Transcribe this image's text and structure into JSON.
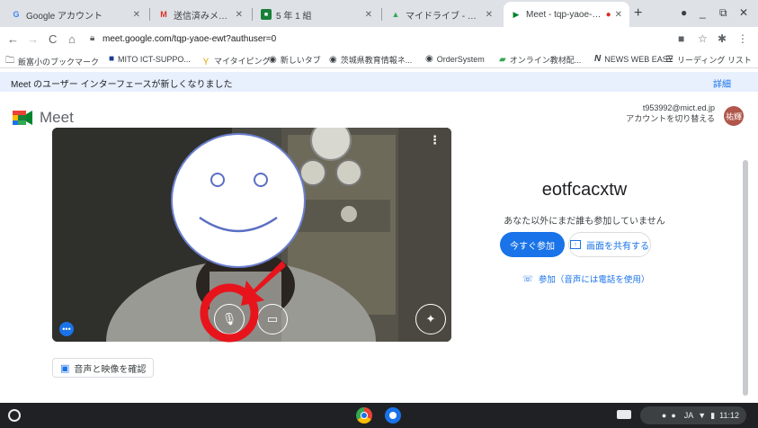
{
  "browser": {
    "tabs": [
      {
        "label": "Google アカウント",
        "icon": "google-g-icon",
        "icon_color": "#4285f4",
        "glyph": "G"
      },
      {
        "label": "送信済みメール - t953992@",
        "icon": "gmail-icon",
        "icon_color": "#d93025",
        "glyph": "M"
      },
      {
        "label": "5 年 1 組",
        "icon": "classroom-icon",
        "icon_color": "#188038",
        "glyph": "■"
      },
      {
        "label": "マイドライブ - Google ドラ",
        "icon": "drive-icon",
        "icon_color": "#fbbc04",
        "glyph": "▲"
      },
      {
        "label": "Meet - tqp-yaoe-ewt",
        "icon": "meet-icon",
        "icon_color": "#00832d",
        "glyph": "▶"
      }
    ],
    "url": "meet.google.com/tqp-yaoe-ewt?authuser=0",
    "bookmarks": [
      {
        "label": "飯富小のブックマーク",
        "icon": "folder-icon"
      },
      {
        "label": "MITO ICT-SUPPO...",
        "icon": "site-icon"
      },
      {
        "label": "マイタイピング",
        "icon": "typing-icon"
      },
      {
        "label": "新しいタブ",
        "icon": "globe-icon"
      },
      {
        "label": "茨城県教育情報ネ...",
        "icon": "globe-icon"
      },
      {
        "label": "OrderSystem",
        "icon": "globe-icon"
      },
      {
        "label": "オンライン教材配...",
        "icon": "site-icon"
      },
      {
        "label": "NEWS WEB EASY",
        "icon": "nhk-icon"
      }
    ],
    "reading_list": "リーディング リスト"
  },
  "banner": {
    "text": "Meet のユーザー インターフェースが新しくなりました",
    "details": "詳細"
  },
  "meet": {
    "logo_text": "Meet",
    "account_email": "t953992@mict.ed.jp",
    "switch_account": "アカウントを切り替える",
    "avatar_text": "祐輝",
    "room_code": "eotfcacxtw",
    "nobody_text": "あなた以外にまだ誰も参加していません",
    "join_now": "今すぐ参加",
    "share_screen": "画面を共有する",
    "phone_join": "参加（音声には電話を使用）",
    "check_av": "音声と映像を確認"
  },
  "shelf": {
    "ime": "JA",
    "time": "11:12"
  },
  "colors": {
    "accent": "#1a73e8",
    "annotation_red": "#e8141c"
  }
}
